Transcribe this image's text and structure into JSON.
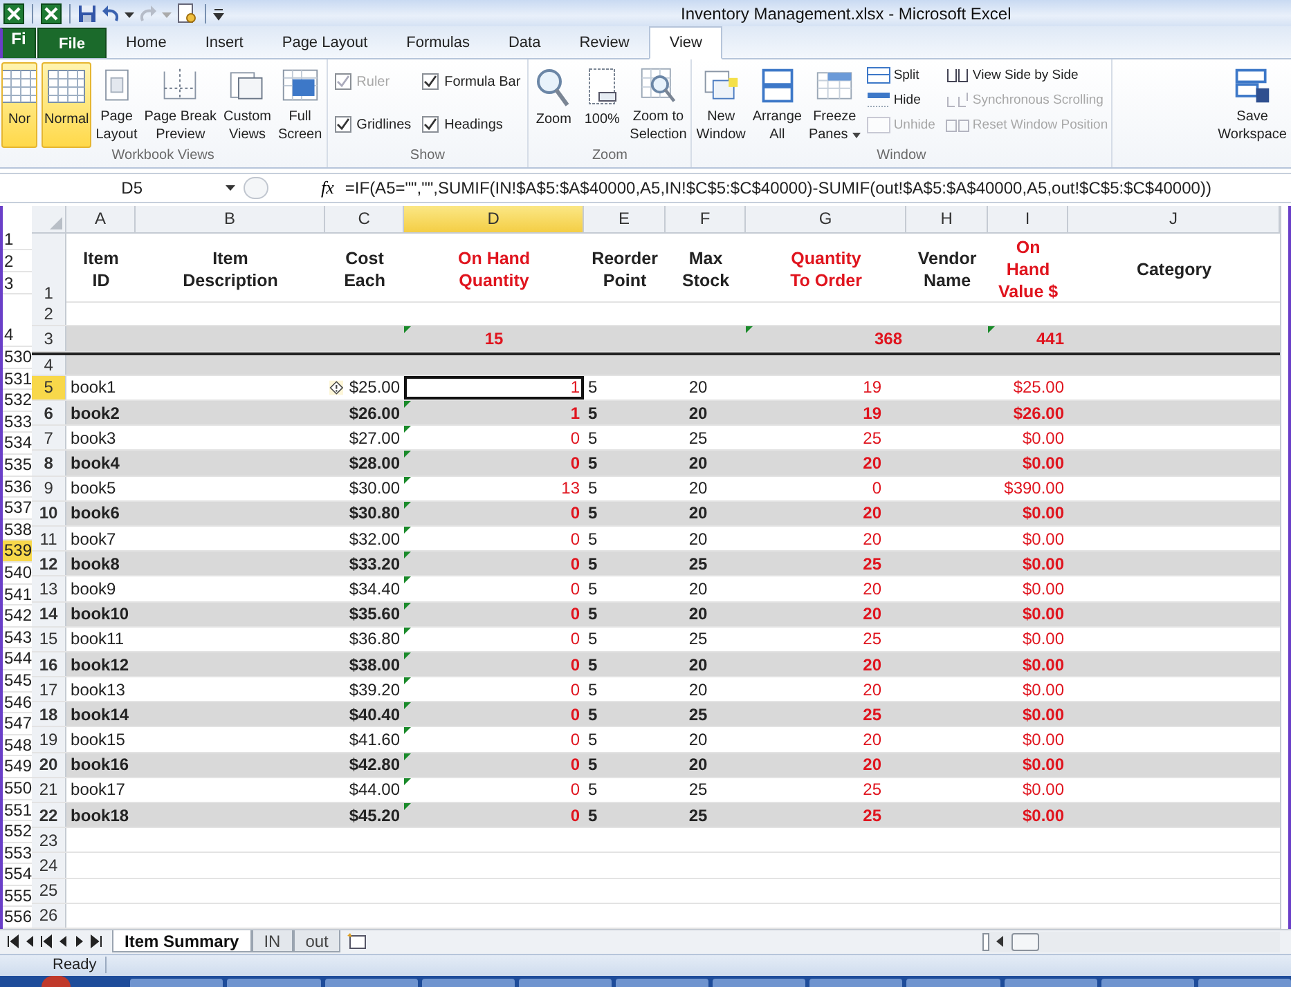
{
  "window": {
    "title": "Inventory Management.xlsx  -  Microsoft Excel"
  },
  "ribbon_tabs": [
    {
      "label": "Fi",
      "kind": "file"
    },
    {
      "label": "File",
      "kind": "file"
    },
    {
      "label": "Home",
      "kind": "tab",
      "selected": false
    },
    {
      "label": "Insert",
      "kind": "tab",
      "selected": false
    },
    {
      "label": "Page Layout",
      "kind": "tab",
      "selected": false
    },
    {
      "label": "Formulas",
      "kind": "tab",
      "selected": false
    },
    {
      "label": "Data",
      "kind": "tab",
      "selected": false
    },
    {
      "label": "Review",
      "kind": "tab",
      "selected": false
    },
    {
      "label": "View",
      "kind": "tab",
      "selected": true
    }
  ],
  "workbook_views": {
    "label": "Workbook Views",
    "buttons": [
      {
        "lines": [
          "Nor"
        ],
        "selected": true
      },
      {
        "lines": [
          "Normal"
        ],
        "selected": true
      },
      {
        "lines": [
          "Page",
          "Layout"
        ],
        "selected": false
      },
      {
        "lines": [
          "Page Break",
          "Preview"
        ],
        "selected": false
      },
      {
        "lines": [
          "Custom",
          "Views"
        ],
        "selected": false
      },
      {
        "lines": [
          "Full",
          "Screen"
        ],
        "selected": false
      }
    ]
  },
  "show": {
    "label": "Show",
    "checkboxes": [
      {
        "label": "Ruler",
        "checked": true,
        "disabled": true
      },
      {
        "label": "Formula Bar",
        "checked": true,
        "disabled": false
      },
      {
        "label": "Gridlines",
        "checked": true,
        "disabled": false
      },
      {
        "label": "Headings",
        "checked": true,
        "disabled": false
      }
    ]
  },
  "zoom": {
    "label": "Zoom",
    "buttons": [
      {
        "lines": [
          "Zoom"
        ]
      },
      {
        "lines": [
          "100%"
        ]
      },
      {
        "lines": [
          "Zoom to",
          "Selection"
        ]
      }
    ]
  },
  "window_group": {
    "label": "Window",
    "buttons": [
      {
        "lines": [
          "New",
          "Window"
        ]
      },
      {
        "lines": [
          "Arrange",
          "All"
        ]
      },
      {
        "lines": [
          "Freeze",
          "Panes"
        ]
      }
    ],
    "small_buttons": [
      {
        "label": "Split",
        "disabled": false
      },
      {
        "label": "Hide",
        "disabled": false
      },
      {
        "label": "Unhide",
        "disabled": true
      },
      {
        "label": "View Side by Side",
        "disabled": false
      },
      {
        "label": "Synchronous Scrolling",
        "disabled": true
      },
      {
        "label": "Reset Window Position",
        "disabled": true
      }
    ],
    "save": {
      "lines": [
        "Save",
        "Workspace"
      ]
    }
  },
  "formula_bar": {
    "name_box": "D5",
    "function_label": "fx",
    "formula": "=IF(A5=\"\",\"\",SUMIF(IN!$A$5:$A$40000,A5,IN!$C$5:$C$40000)-SUMIF(out!$A$5:$A$40000,A5,out!$C$5:$C$40000))"
  },
  "columns": [
    {
      "letter": "A",
      "selected": false
    },
    {
      "letter": "B",
      "selected": false
    },
    {
      "letter": "C",
      "selected": false
    },
    {
      "letter": "D",
      "selected": true
    },
    {
      "letter": "E",
      "selected": false
    },
    {
      "letter": "F",
      "selected": false
    },
    {
      "letter": "G",
      "selected": false
    },
    {
      "letter": "H",
      "selected": false
    },
    {
      "letter": "I",
      "selected": false
    },
    {
      "letter": "J",
      "selected": false
    }
  ],
  "background_row_numbers": [
    {
      "label": "1",
      "selected": false
    },
    {
      "label": "2",
      "selected": false
    },
    {
      "label": "3",
      "selected": false
    },
    {
      "label": "4",
      "selected": false
    },
    {
      "label": "530",
      "selected": false
    },
    {
      "label": "531",
      "selected": false
    },
    {
      "label": "532",
      "selected": false
    },
    {
      "label": "533",
      "selected": false
    },
    {
      "label": "534",
      "selected": false
    },
    {
      "label": "535",
      "selected": false
    },
    {
      "label": "536",
      "selected": false
    },
    {
      "label": "537",
      "selected": false
    },
    {
      "label": "538",
      "selected": false
    },
    {
      "label": "539",
      "selected": true
    },
    {
      "label": "540",
      "selected": false
    },
    {
      "label": "541",
      "selected": false
    },
    {
      "label": "542",
      "selected": false
    },
    {
      "label": "543",
      "selected": false
    },
    {
      "label": "544",
      "selected": false
    },
    {
      "label": "545",
      "selected": false
    },
    {
      "label": "546",
      "selected": false
    },
    {
      "label": "547",
      "selected": false
    },
    {
      "label": "548",
      "selected": false
    },
    {
      "label": "549",
      "selected": false
    },
    {
      "label": "550",
      "selected": false
    },
    {
      "label": "551",
      "selected": false
    },
    {
      "label": "552",
      "selected": false
    },
    {
      "label": "553",
      "selected": false
    },
    {
      "label": "554",
      "selected": false
    },
    {
      "label": "555",
      "selected": false
    },
    {
      "label": "556",
      "selected": false
    }
  ],
  "header_row": {
    "number": "1",
    "cells": [
      {
        "lines": [
          "Item",
          "ID"
        ],
        "emphasis": false
      },
      {
        "lines": [
          "Item",
          "Description"
        ],
        "emphasis": false
      },
      {
        "lines": [
          "Cost",
          "Each"
        ],
        "emphasis": false
      },
      {
        "lines": [
          "On Hand",
          "Quantity"
        ],
        "emphasis": true
      },
      {
        "lines": [
          "Reorder",
          "Point"
        ],
        "emphasis": false
      },
      {
        "lines": [
          "Max",
          "Stock"
        ],
        "emphasis": false
      },
      {
        "lines": [
          "Quantity",
          "To Order"
        ],
        "emphasis": true
      },
      {
        "lines": [
          "Vendor",
          "Name"
        ],
        "emphasis": false
      },
      {
        "lines": [
          "On",
          "Hand",
          "Value $"
        ],
        "emphasis": true
      },
      {
        "lines": [
          "Category"
        ],
        "emphasis": false
      }
    ]
  },
  "blank_row": {
    "number": "2"
  },
  "totals_row": {
    "number": "3",
    "on_hand": "15",
    "to_order": "368",
    "value": "441"
  },
  "spacer_row": {
    "number": "4"
  },
  "rows": [
    {
      "number": "5",
      "selected": true,
      "shaded": false,
      "flagged": false,
      "item": "book1",
      "cost": "$25.00",
      "on_hand": "1",
      "reorder": "5",
      "max": "20",
      "to_order": "19",
      "value": "$25.00"
    },
    {
      "number": "6",
      "selected": false,
      "shaded": true,
      "flagged": true,
      "item": "book2",
      "cost": "$26.00",
      "on_hand": "1",
      "reorder": "5",
      "max": "20",
      "to_order": "19",
      "value": "$26.00"
    },
    {
      "number": "7",
      "selected": false,
      "shaded": false,
      "flagged": true,
      "item": "book3",
      "cost": "$27.00",
      "on_hand": "0",
      "reorder": "5",
      "max": "25",
      "to_order": "25",
      "value": "$0.00"
    },
    {
      "number": "8",
      "selected": false,
      "shaded": true,
      "flagged": true,
      "item": "book4",
      "cost": "$28.00",
      "on_hand": "0",
      "reorder": "5",
      "max": "20",
      "to_order": "20",
      "value": "$0.00"
    },
    {
      "number": "9",
      "selected": false,
      "shaded": false,
      "flagged": true,
      "item": "book5",
      "cost": "$30.00",
      "on_hand": "13",
      "reorder": "5",
      "max": "20",
      "to_order": "0",
      "value": "$390.00"
    },
    {
      "number": "10",
      "selected": false,
      "shaded": true,
      "flagged": true,
      "item": "book6",
      "cost": "$30.80",
      "on_hand": "0",
      "reorder": "5",
      "max": "20",
      "to_order": "20",
      "value": "$0.00"
    },
    {
      "number": "11",
      "selected": false,
      "shaded": false,
      "flagged": true,
      "item": "book7",
      "cost": "$32.00",
      "on_hand": "0",
      "reorder": "5",
      "max": "20",
      "to_order": "20",
      "value": "$0.00"
    },
    {
      "number": "12",
      "selected": false,
      "shaded": true,
      "flagged": true,
      "item": "book8",
      "cost": "$33.20",
      "on_hand": "0",
      "reorder": "5",
      "max": "25",
      "to_order": "25",
      "value": "$0.00"
    },
    {
      "number": "13",
      "selected": false,
      "shaded": false,
      "flagged": true,
      "item": "book9",
      "cost": "$34.40",
      "on_hand": "0",
      "reorder": "5",
      "max": "20",
      "to_order": "20",
      "value": "$0.00"
    },
    {
      "number": "14",
      "selected": false,
      "shaded": true,
      "flagged": true,
      "item": "book10",
      "cost": "$35.60",
      "on_hand": "0",
      "reorder": "5",
      "max": "20",
      "to_order": "20",
      "value": "$0.00"
    },
    {
      "number": "15",
      "selected": false,
      "shaded": false,
      "flagged": true,
      "item": "book11",
      "cost": "$36.80",
      "on_hand": "0",
      "reorder": "5",
      "max": "25",
      "to_order": "25",
      "value": "$0.00"
    },
    {
      "number": "16",
      "selected": false,
      "shaded": true,
      "flagged": true,
      "item": "book12",
      "cost": "$38.00",
      "on_hand": "0",
      "reorder": "5",
      "max": "20",
      "to_order": "20",
      "value": "$0.00"
    },
    {
      "number": "17",
      "selected": false,
      "shaded": false,
      "flagged": true,
      "item": "book13",
      "cost": "$39.20",
      "on_hand": "0",
      "reorder": "5",
      "max": "20",
      "to_order": "20",
      "value": "$0.00"
    },
    {
      "number": "18",
      "selected": false,
      "shaded": true,
      "flagged": true,
      "item": "book14",
      "cost": "$40.40",
      "on_hand": "0",
      "reorder": "5",
      "max": "25",
      "to_order": "25",
      "value": "$0.00"
    },
    {
      "number": "19",
      "selected": false,
      "shaded": false,
      "flagged": true,
      "item": "book15",
      "cost": "$41.60",
      "on_hand": "0",
      "reorder": "5",
      "max": "20",
      "to_order": "20",
      "value": "$0.00"
    },
    {
      "number": "20",
      "selected": false,
      "shaded": true,
      "flagged": true,
      "item": "book16",
      "cost": "$42.80",
      "on_hand": "0",
      "reorder": "5",
      "max": "20",
      "to_order": "20",
      "value": "$0.00"
    },
    {
      "number": "21",
      "selected": false,
      "shaded": false,
      "flagged": true,
      "item": "book17",
      "cost": "$44.00",
      "on_hand": "0",
      "reorder": "5",
      "max": "25",
      "to_order": "25",
      "value": "$0.00"
    },
    {
      "number": "22",
      "selected": false,
      "shaded": true,
      "flagged": true,
      "item": "book18",
      "cost": "$45.20",
      "on_hand": "0",
      "reorder": "5",
      "max": "25",
      "to_order": "25",
      "value": "$0.00"
    }
  ],
  "empty_rows": [
    "23",
    "24",
    "25",
    "26"
  ],
  "sheet_tabs": [
    {
      "label": "Item Summary",
      "selected": true
    },
    {
      "label": "IN",
      "selected": false
    },
    {
      "label": "out",
      "selected": false
    }
  ],
  "status_bar": {
    "status": "Ready"
  }
}
